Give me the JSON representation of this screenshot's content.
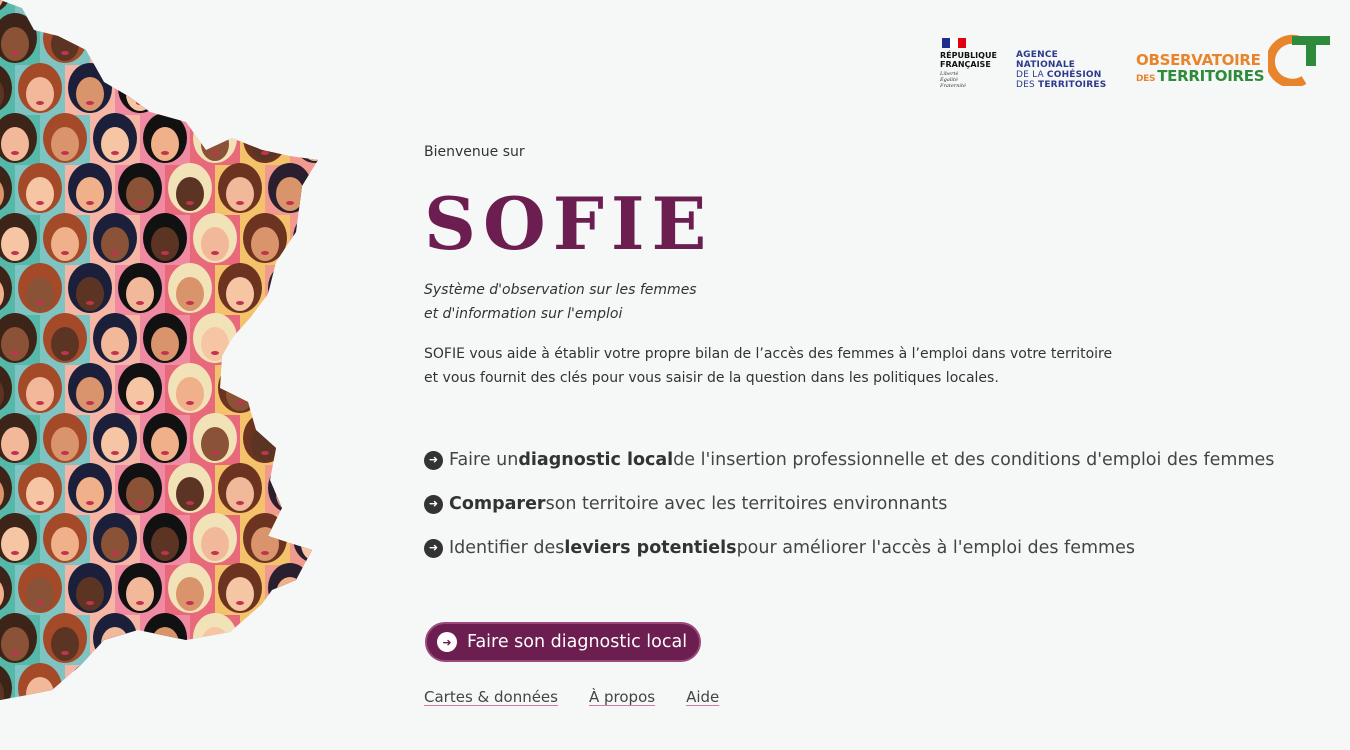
{
  "header": {
    "rf_title_line1": "RÉPUBLIQUE",
    "rf_title_line2": "FRANÇAISE",
    "rf_motto_line1": "Liberté",
    "rf_motto_line2": "Égalité",
    "rf_motto_line3": "Fraternité",
    "anct_line1": "AGENCE",
    "anct_line2": "NATIONALE",
    "anct_line3_pre": "DE LA ",
    "anct_line3_bold": "COHÉSION",
    "anct_line4_pre": "DES ",
    "anct_line4_bold": "TERRITOIRES",
    "obs_line1": "OBSERVATOIRE",
    "obs_line2_small": "DES",
    "obs_line2": "TERRITOIRES"
  },
  "intro": {
    "welcome": "Bienvenue sur",
    "title": "SOFIE",
    "subtitle_line1": "Système d'observation sur les femmes",
    "subtitle_line2": "et d'information sur l'emploi",
    "desc_line1": "SOFIE vous aide à établir votre propre bilan de l’accès des femmes à l’emploi dans votre territoire",
    "desc_line2": "et vous fournit des clés pour vous saisir de la question dans les politiques locales."
  },
  "features": [
    {
      "pre": "Faire un ",
      "bold": "diagnostic local",
      "post": " de l'insertion professionnelle et des conditions d'emploi des femmes"
    },
    {
      "pre": "",
      "bold": "Comparer",
      "post": " son territoire avec les territoires environnants"
    },
    {
      "pre": "Identifier des ",
      "bold": "leviers potentiels",
      "post": " pour améliorer l'accès à l'emploi des femmes"
    }
  ],
  "cta": {
    "label": "Faire son diagnostic local"
  },
  "links": [
    "Cartes & données",
    "À propos",
    "Aide"
  ],
  "colors": {
    "brand": "#6b1e4f",
    "background": "#f6f8f8",
    "text": "#333333",
    "link_underline": "#d47aa8",
    "obs_orange": "#e8842b",
    "obs_green": "#2f8b3c",
    "anct_blue": "#2c3a8c"
  },
  "icons": {
    "feature_bullet": "arrow-right-circle-icon",
    "cta": "arrow-right-circle-icon"
  }
}
